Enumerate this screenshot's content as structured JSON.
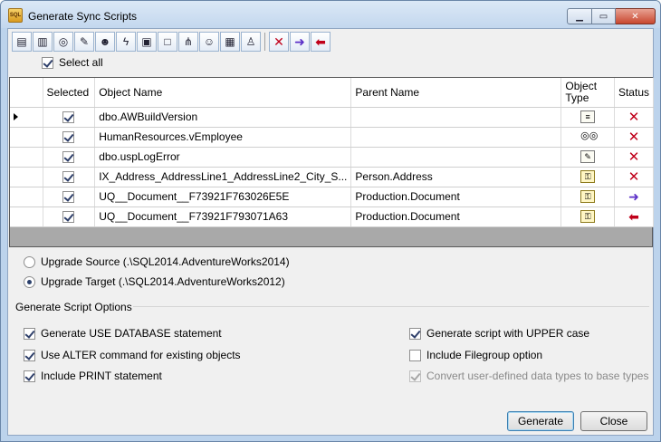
{
  "window": {
    "title": "Generate Sync Scripts",
    "icon_label": "SQL"
  },
  "toolbar": {
    "tools": [
      "tables-icon",
      "columns-icon",
      "views-icon",
      "procedures-icon",
      "users-icon",
      "functions-icon",
      "triggers-icon",
      "defaults-icon",
      "relations-icon",
      "roles-icon",
      "schemas-icon",
      "logins-icon"
    ],
    "actions": [
      "delete-icon",
      "arrow-right-icon",
      "arrow-left-icon"
    ]
  },
  "select_all": {
    "label": "Select all",
    "checked": true
  },
  "grid": {
    "columns": [
      "Selected",
      "Object Name",
      "Parent Name",
      "Object Type",
      "Status"
    ],
    "rows": [
      {
        "selected": true,
        "name": "dbo.AWBuildVersion",
        "parent": "",
        "type": "table-icon",
        "status": "delete"
      },
      {
        "selected": true,
        "name": "HumanResources.vEmployee",
        "parent": "",
        "type": "view-icon",
        "status": "delete"
      },
      {
        "selected": true,
        "name": "dbo.uspLogError",
        "parent": "",
        "type": "procedure-icon",
        "status": "delete"
      },
      {
        "selected": true,
        "name": "IX_Address_AddressLine1_AddressLine2_City_S...",
        "parent": "Person.Address",
        "type": "index-icon",
        "status": "delete"
      },
      {
        "selected": true,
        "name": "UQ__Document__F73921F763026E5E",
        "parent": "Production.Document",
        "type": "key-icon",
        "status": "right"
      },
      {
        "selected": true,
        "name": "UQ__Document__F73921F793071A63",
        "parent": "Production.Document",
        "type": "key-icon",
        "status": "left"
      }
    ]
  },
  "upgrade": {
    "source": "Upgrade Source (.\\SQL2014.AdventureWorks2014)",
    "target": "Upgrade Target (.\\SQL2014.AdventureWorks2012)"
  },
  "options": {
    "group_label": "Generate Script Options",
    "use_database": "Generate USE DATABASE statement",
    "use_alter": "Use ALTER command for existing objects",
    "include_print": "Include PRINT statement",
    "upper_case": "Generate script with UPPER case",
    "filegroup": "Include Filegroup option",
    "convert_types": "Convert user-defined data types to base types"
  },
  "buttons": {
    "generate": "Generate",
    "close": "Close"
  }
}
